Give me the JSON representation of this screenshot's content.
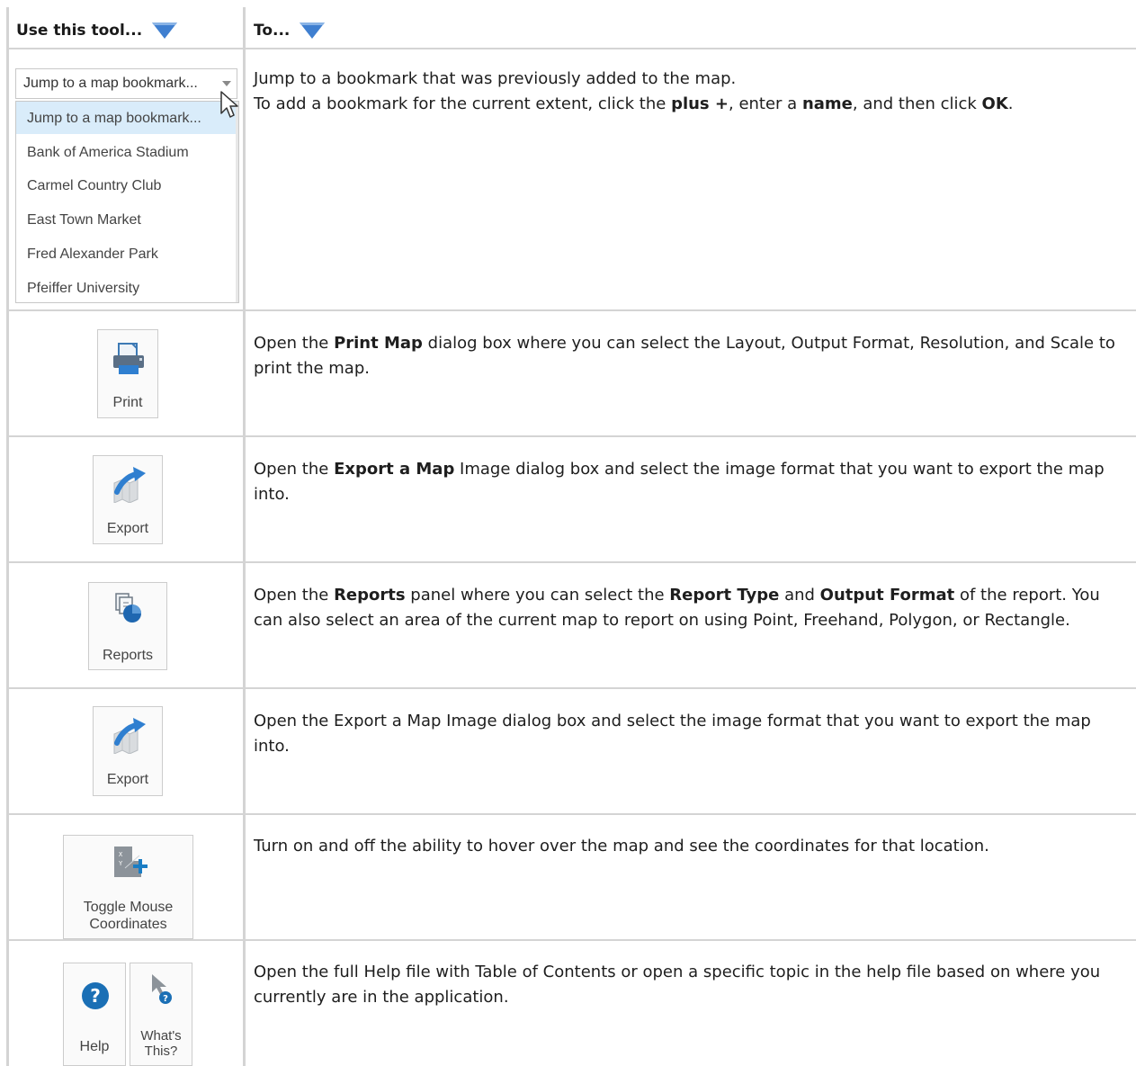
{
  "headers": {
    "tool": "Use this tool...",
    "to": "To..."
  },
  "bookmark": {
    "selected_value": "Jump to a map bookmark...",
    "options": [
      "Jump to a map bookmark...",
      "Bank of America Stadium",
      "Carmel Country Club",
      "East Town Market",
      "Fred Alexander Park",
      "Pfeiffer University"
    ],
    "desc_line1": "Jump to a bookmark that was previously added to the map.",
    "desc_line2_a": "To add a bookmark for the current extent, click the ",
    "desc_line2_plus": "plus +",
    "desc_line2_b": ", enter a ",
    "desc_line2_name": "name",
    "desc_line2_c": ", and then click ",
    "desc_line2_ok": "OK",
    "desc_line2_d": "."
  },
  "print": {
    "label": "Print",
    "d_a": "Open the ",
    "d_bold": "Print Map",
    "d_b": " dialog box where you can select the Layout, Output Format, Resolution, and Scale to print the map."
  },
  "export1": {
    "label": "Export",
    "d_a": "Open the ",
    "d_bold": "Export a Map",
    "d_b": " Image dialog box and select the image format that you want to export the map into."
  },
  "reports": {
    "label": "Reports",
    "d_a": "Open the ",
    "d_bold1": "Reports",
    "d_b": " panel where you can select the ",
    "d_bold2": "Report Type",
    "d_c": " and ",
    "d_bold3": "Output Format",
    "d_d": " of the report. You can also select an area of the current map to report on using Point, Freehand, Polygon, or Rectangle."
  },
  "export2": {
    "label": "Export",
    "desc": "Open the Export a Map Image dialog box and select the image format that you want to export the map into."
  },
  "coords": {
    "label_line1": "Toggle Mouse",
    "label_line2": "Coordinates",
    "desc": "Turn on and off the ability to hover over the map and see the coordinates for that location."
  },
  "help": {
    "help_label": "Help",
    "whats_line1": "What's",
    "whats_line2": "This?",
    "desc": "Open the full Help file with Table of Contents or open a specific topic in the help file based on where you currently are in the application."
  },
  "colors": {
    "accent_blue": "#1a7dc4",
    "triangle": "#3f7fd0",
    "grid": "#d4d4d4"
  }
}
